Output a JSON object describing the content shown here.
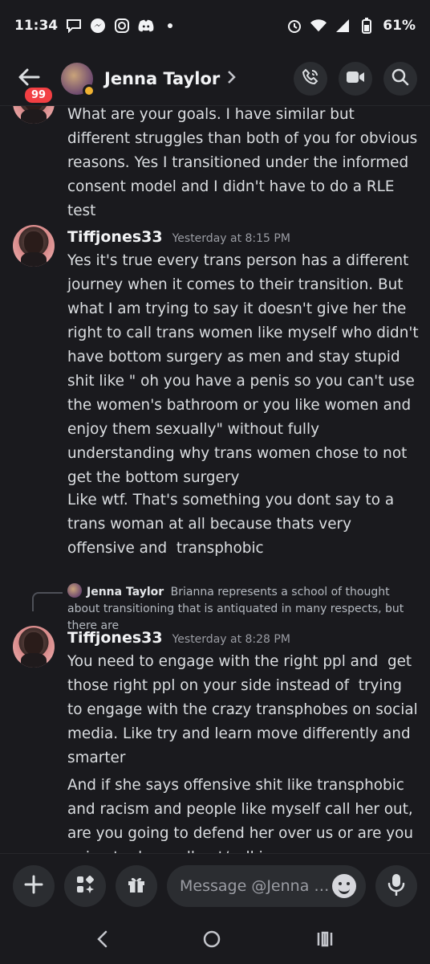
{
  "status_bar": {
    "time": "11:34",
    "battery": "61%"
  },
  "header": {
    "badge_count": "99",
    "contact_name": "Jenna Taylor"
  },
  "messages": {
    "m0": {
      "text": "What are your goals. I have similar but different struggles than both of you for obvious reasons. Yes I transitioned under the informed consent model and I didn't have to do a RLE test"
    },
    "m1": {
      "author": "Tiffjones33",
      "time": "Yesterday at 8:15 PM",
      "text1": "Yes it's true every trans person has a different journey when it comes to their transition. But what I am trying to say it doesn't give her the right to call trans women like myself who didn't have bottom surgery as men and stay stupid shit like \" oh you have a penis so you can't use the women's bathroom or you like women and enjoy them sexually\" without fully understanding why trans women chose to not get the bottom surgery",
      "text2": "Like wtf. That's something you dont say to a trans woman at all because thats very offensive and  transphobic"
    },
    "reply": {
      "author": "Jenna Taylor",
      "preview": "Brianna represents a school of thought about transitioning that is antiquated in many respects, but there are"
    },
    "m2": {
      "author": "Tiffjones33",
      "time": "Yesterday at 8:28 PM",
      "text1": "You need to engage with the right ppl and  get those right ppl on your side instead of  trying to engage with the crazy transphobes on social media. Like try and learn move differently and smarter",
      "text2": "And if she says offensive shit like transphobic and racism and people like myself call her out, are you going to defend her over us or are you going to do a call out/call in"
    }
  },
  "composer": {
    "placeholder": "Message @Jenna T..."
  },
  "icons": {
    "back": "arrow-left-icon",
    "voice_call": "phone-call-icon",
    "video_call": "video-camera-icon",
    "search": "search-icon",
    "add": "plus-icon",
    "apps": "apps-icon",
    "gift": "gift-icon",
    "emoji": "emoji-icon",
    "mic": "microphone-icon"
  },
  "colors": {
    "background": "#1a1a1e",
    "badge": "#f23f43",
    "status_idle": "#f0b232"
  }
}
